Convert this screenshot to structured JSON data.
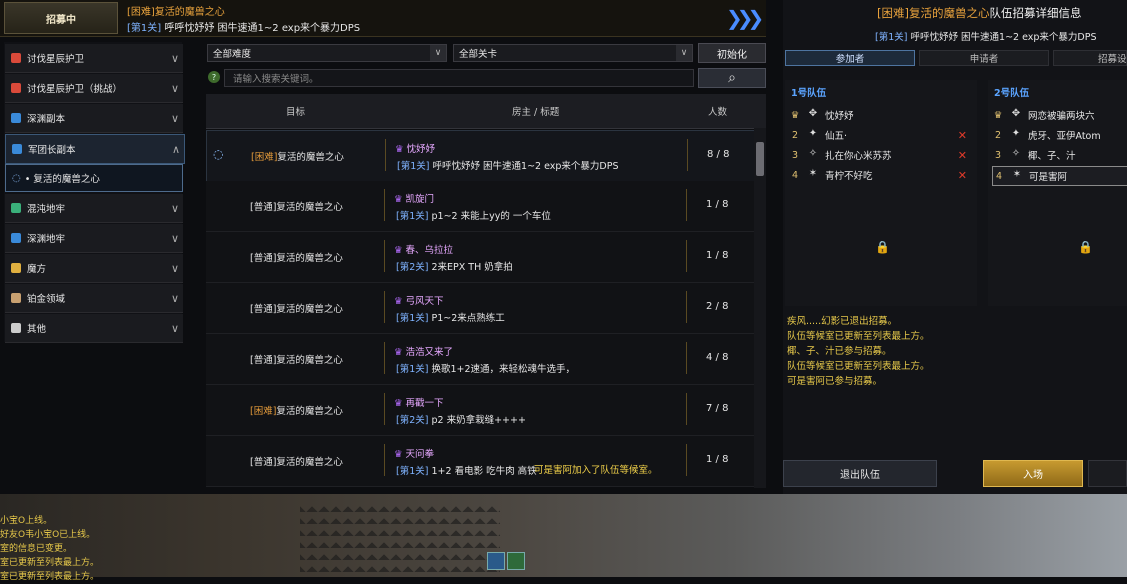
{
  "banner": {
    "badge": "招募中",
    "title": "[困难]复活的魔兽之心",
    "sub_tag": "[第1关]",
    "sub_text": "呼呼忱妤妤 困牛速通1~2 exp来个暴力DPS",
    "chevron": "❯❯❯"
  },
  "sidebar": {
    "items": [
      {
        "label": "讨伐星辰护卫",
        "color": "#d94a3a",
        "arrow": "∨"
      },
      {
        "label": "讨伐星辰护卫（挑战）",
        "color": "#d94a3a",
        "arrow": "∨"
      },
      {
        "label": "深渊副本",
        "color": "#3a8ad9",
        "arrow": "∨"
      },
      {
        "label": "军团长副本",
        "color": "#3a8ad9",
        "arrow": "∧"
      },
      {
        "label": "混沌地牢",
        "color": "#3ab07a",
        "arrow": "∨"
      },
      {
        "label": "深渊地牢",
        "color": "#3a8ad9",
        "arrow": "∨"
      },
      {
        "label": "魔方",
        "color": "#e0b040",
        "arrow": "∨"
      },
      {
        "label": "铂金领域",
        "color": "#c8a070",
        "arrow": "∨"
      },
      {
        "label": "其他",
        "color": "#cccccc",
        "arrow": "∨"
      }
    ],
    "sub_item": "• 复活的魔兽之心"
  },
  "filters": {
    "difficulty": "全部难度",
    "stage": "全部关卡",
    "init_label": "初始化",
    "search_placeholder": "请输入搜索关键词。",
    "dropdown_glyph": "∨",
    "help_glyph": "?",
    "search_glyph": "⌕"
  },
  "table": {
    "headers": {
      "goal": "目标",
      "host": "房主 / 标题",
      "count": "人数"
    },
    "rows": [
      {
        "diff": "[困难]",
        "goal": "复活的魔兽之心",
        "host": "忱妤妤",
        "tag": "[第1关]",
        "title": "呼呼忱妤妤 困牛速通1~2 exp来个暴力DPS",
        "count": "8 / 8",
        "selected": true
      },
      {
        "diff": "[普通]",
        "goal": "复活的魔兽之心",
        "host": "凯旋门",
        "tag": "[第1关]",
        "title": "p1~2 来能上yy的 一个车位",
        "count": "1 / 8"
      },
      {
        "diff": "[普通]",
        "goal": "复活的魔兽之心",
        "host": "春、乌拉拉",
        "tag": "[第2关]",
        "title": "2来EPX TH 奶拿拍",
        "count": "1 / 8"
      },
      {
        "diff": "[普通]",
        "goal": "复活的魔兽之心",
        "host": "弓风天下",
        "tag": "[第1关]",
        "title": "P1~2来点熟练工",
        "count": "2 / 8"
      },
      {
        "diff": "[普通]",
        "goal": "复活的魔兽之心",
        "host": "浩浩又来了",
        "tag": "[第1关]",
        "title": "换歌1+2速通，来轻松魂牛选手，",
        "count": "4 / 8"
      },
      {
        "diff": "[困难]",
        "goal": "复活的魔兽之心",
        "host": "再戳一下",
        "tag": "[第2关]",
        "title": "p2 来奶拿栽缝++++",
        "count": "7 / 8"
      },
      {
        "diff": "[普通]",
        "goal": "复活的魔兽之心",
        "host": "天问拳",
        "tag": "[第1关]",
        "title": "1+2 看电影 吃牛肉 高铁",
        "count": "1 / 8"
      }
    ]
  },
  "toast": "可是害阿加入了队伍等候室。",
  "detail": {
    "title_hl": "[困难]复活的魔兽之心",
    "title_rest": "队伍招募详细信息",
    "sub_tag": "[第1关]",
    "sub_text": "呼呼忱妤妤 困牛速通1~2 exp来个暴力DPS",
    "tabs": [
      "参加者",
      "申请者",
      "招募设"
    ],
    "party1": {
      "label": "1号队伍",
      "members": [
        {
          "num": "♛",
          "name": "忱妤妤",
          "cls": "✥",
          "kick": ""
        },
        {
          "num": "2",
          "name": "仙五·",
          "cls": "✦",
          "kick": "✕"
        },
        {
          "num": "3",
          "name": "扎在你心米苏苏",
          "cls": "✧",
          "kick": "✕"
        },
        {
          "num": "4",
          "name": "青柠不好吃",
          "cls": "✶",
          "kick": "✕"
        }
      ]
    },
    "party2": {
      "label": "2号队伍",
      "members": [
        {
          "num": "♛",
          "name": "网恋被骗两块六",
          "cls": "✥",
          "kick": ""
        },
        {
          "num": "2",
          "name": "虎牙、亚伊Atom",
          "cls": "✦",
          "kick": ""
        },
        {
          "num": "3",
          "name": "椰、子、汁",
          "cls": "✧",
          "kick": ""
        },
        {
          "num": "4",
          "name": "可是害阿",
          "cls": "✶",
          "kick": ""
        }
      ]
    },
    "lock_glyph": "🔒",
    "log": [
      "疾风.....幻影已退出招募。",
      "队伍等候室已更新至列表最上方。",
      "椰、子、汁已参与招募。",
      "队伍等候室已更新至列表最上方。",
      "可是害阿已参与招募。"
    ],
    "leave_label": "退出队伍",
    "enter_label": "入场"
  },
  "chat": [
    "小宝O上线。",
    "好友O韦小宝O已上线。",
    "室的信息已变更。",
    "室已更新至列表最上方。",
    "室已更新至列表最上方。"
  ]
}
